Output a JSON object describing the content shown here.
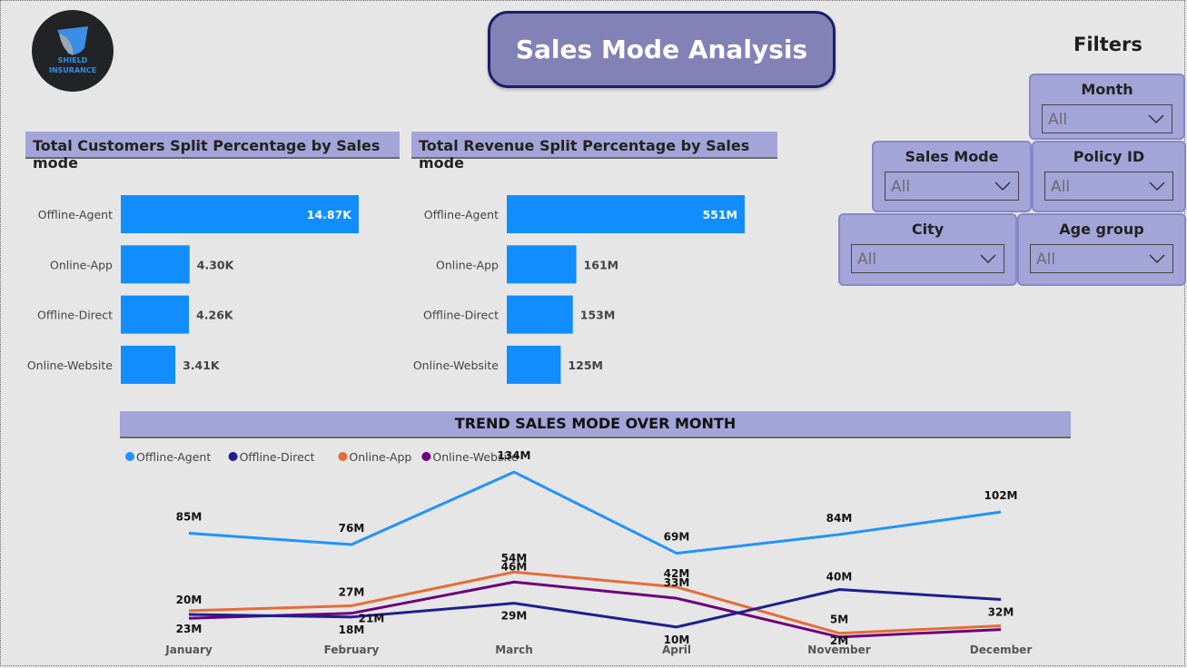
{
  "logo": {
    "line1": "SHIELD",
    "line2": "INSURANCE"
  },
  "header": {
    "title": "Sales Mode Analysis"
  },
  "filters": {
    "title": "Filters",
    "month": {
      "label": "Month",
      "value": "All"
    },
    "sales_mode": {
      "label": "Sales Mode",
      "value": "All"
    },
    "policy_id": {
      "label": "Policy ID",
      "value": "All"
    },
    "city": {
      "label": "City",
      "value": "All"
    },
    "age_group": {
      "label": "Age group",
      "value": "All"
    }
  },
  "colors": {
    "bar": "#118dff",
    "offline_agent": "#1f93ff",
    "offline_direct": "#1e1e8f",
    "online_app": "#e66c37",
    "online_website": "#6b007b",
    "panel": "#a3a5d8"
  },
  "chart_data": [
    {
      "type": "bar",
      "orientation": "horizontal",
      "title": "Total Customers Split Percentage by Sales mode",
      "categories": [
        "Offline-Agent",
        "Online-App",
        "Offline-Direct",
        "Online-Website"
      ],
      "values": [
        14870,
        4300,
        4260,
        3410
      ],
      "labels": [
        "14.87K",
        "4.30K",
        "4.26K",
        "3.41K"
      ]
    },
    {
      "type": "bar",
      "orientation": "horizontal",
      "title": "Total Revenue Split Percentage by Sales mode",
      "categories": [
        "Offline-Agent",
        "Online-App",
        "Offline-Direct",
        "Online-Website"
      ],
      "values": [
        551,
        161,
        153,
        125
      ],
      "labels": [
        "551M",
        "161M",
        "153M",
        "125M"
      ]
    },
    {
      "type": "line",
      "title": "TREND SALES MODE OVER MONTH",
      "x": [
        "January",
        "February",
        "March",
        "April",
        "November",
        "December"
      ],
      "legend": "top-left",
      "series": [
        {
          "name": "Offline-Agent",
          "values": [
            85,
            76,
            134,
            69,
            84,
            102
          ],
          "labels": [
            "85M",
            "76M",
            "134M",
            "69M",
            "84M",
            "102M"
          ]
        },
        {
          "name": "Offline-Direct",
          "values": [
            20,
            18,
            29,
            10,
            40,
            32
          ],
          "labels": [
            "20M",
            "18M",
            "29M",
            "10M",
            "40M",
            ""
          ]
        },
        {
          "name": "Online-App",
          "values": [
            23,
            27,
            54,
            42,
            5,
            11
          ],
          "labels": [
            "",
            "27M",
            "54M",
            "42M",
            "5M",
            "32M"
          ]
        },
        {
          "name": "Online-Website",
          "values": [
            17,
            21,
            46,
            33,
            2,
            8
          ],
          "labels": [
            "23M",
            "21M",
            "46M",
            "33M",
            "2M",
            ""
          ]
        }
      ]
    }
  ]
}
